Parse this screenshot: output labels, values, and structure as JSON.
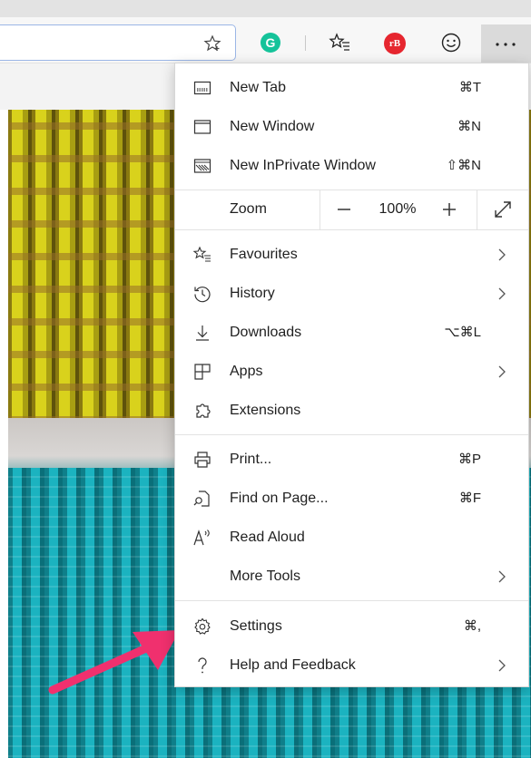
{
  "toolbar": {
    "grammarly_letter": "G",
    "extension_badge": "rB",
    "more_label": "···"
  },
  "menu": {
    "section1": [
      {
        "label": "New Tab",
        "shortcut": "⌘T",
        "icon": "new-tab-icon"
      },
      {
        "label": "New Window",
        "shortcut": "⌘N",
        "icon": "new-window-icon"
      },
      {
        "label": "New InPrivate Window",
        "shortcut": "⇧⌘N",
        "icon": "inprivate-icon"
      }
    ],
    "zoom": {
      "label": "Zoom",
      "minus": "−",
      "value": "100%",
      "plus": "+"
    },
    "section2": [
      {
        "label": "Favourites",
        "icon": "favourites-icon",
        "submenu": true
      },
      {
        "label": "History",
        "icon": "history-icon",
        "submenu": true
      },
      {
        "label": "Downloads",
        "shortcut": "⌥⌘L",
        "icon": "download-icon"
      },
      {
        "label": "Apps",
        "icon": "apps-icon",
        "submenu": true
      },
      {
        "label": "Extensions",
        "icon": "extensions-icon"
      }
    ],
    "section3": [
      {
        "label": "Print...",
        "shortcut": "⌘P",
        "icon": "print-icon"
      },
      {
        "label": "Find on Page...",
        "shortcut": "⌘F",
        "icon": "find-icon"
      },
      {
        "label": "Read Aloud",
        "icon": "read-aloud-icon"
      },
      {
        "label": "More Tools",
        "submenu": true
      }
    ],
    "section4": [
      {
        "label": "Settings",
        "shortcut": "⌘,",
        "icon": "gear-icon"
      },
      {
        "label": "Help and Feedback",
        "icon": "help-icon",
        "submenu": true
      }
    ]
  },
  "colors": {
    "arrow": "#f0306e",
    "grammarly": "#15c39a",
    "badge": "#e6262f"
  }
}
